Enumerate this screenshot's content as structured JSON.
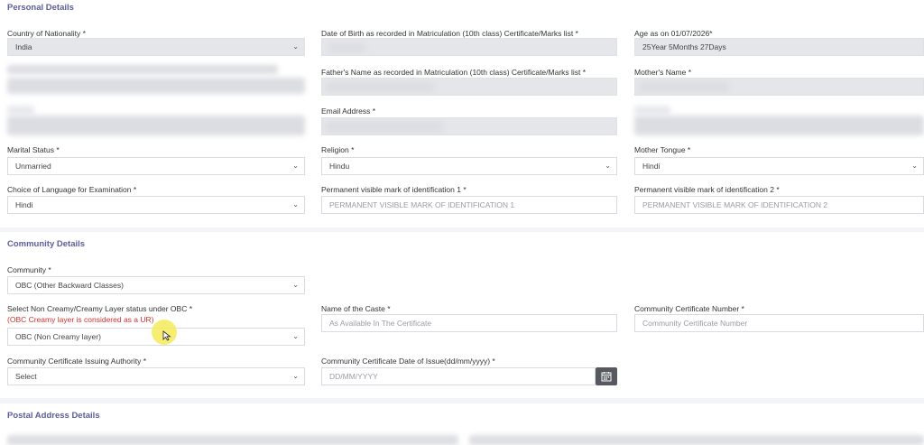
{
  "sections": {
    "personal": "Personal Details",
    "community": "Community Details",
    "postal": "Postal Address Details"
  },
  "personal": {
    "nationality_label": "Country of Nationality *",
    "nationality_value": "India",
    "dob_label": "Date of Birth as recorded in Matriculation (10th class) Certificate/Marks list *",
    "age_label": "Age as on 01/07/2026*",
    "age_value": "25Year   5Months   27Days",
    "father_label": "Father's Name as recorded in Matriculation (10th class) Certificate/Marks list *",
    "mother_label": "Mother's Name *",
    "email_label": "Email Address *",
    "marital_label": "Marital Status *",
    "marital_value": "Unmarried",
    "religion_label": "Religion *",
    "religion_value": "Hindu",
    "tongue_label": "Mother Tongue *",
    "tongue_value": "Hindi",
    "language_label": "Choice of Language for Examination *",
    "language_value": "Hindi",
    "mark1_label": "Permanent visible mark of identification 1 *",
    "mark1_value": "PERMANENT VISIBLE MARK OF IDENTIFICATION 1",
    "mark2_label": "Permanent visible mark of identification 2 *",
    "mark2_value": "PERMANENT VISIBLE MARK OF IDENTIFICATION 2"
  },
  "community": {
    "community_label": "Community *",
    "community_value": "OBC (Other Backward Classes)",
    "creamy_label": "Select Non Creamy/Creamy Layer status under OBC  *",
    "creamy_warning": "(OBC Creamy layer is considered as a UR)",
    "creamy_value": "OBC (Non Creamy layer)",
    "caste_label": "Name of the Caste *",
    "caste_placeholder": "As Available In The Certificate",
    "cert_number_label": "Community Certificate Number *",
    "cert_number_placeholder": "Community Certificate Number",
    "authority_label": "Community Certificate Issuing Authority *",
    "authority_value": "Select",
    "issue_date_label": "Community Certificate Date of Issue(dd/mm/yyyy) *",
    "issue_date_placeholder": "DD/MM/YYYY"
  },
  "icons": {
    "dropdown": "chevron-down-icon",
    "calendar": "calendar-icon"
  },
  "colors": {
    "section_title": "#5a5e9c",
    "warning": "#d9302c",
    "disabled_field": "#e5e6ea",
    "calendar_button": "#56595f"
  }
}
